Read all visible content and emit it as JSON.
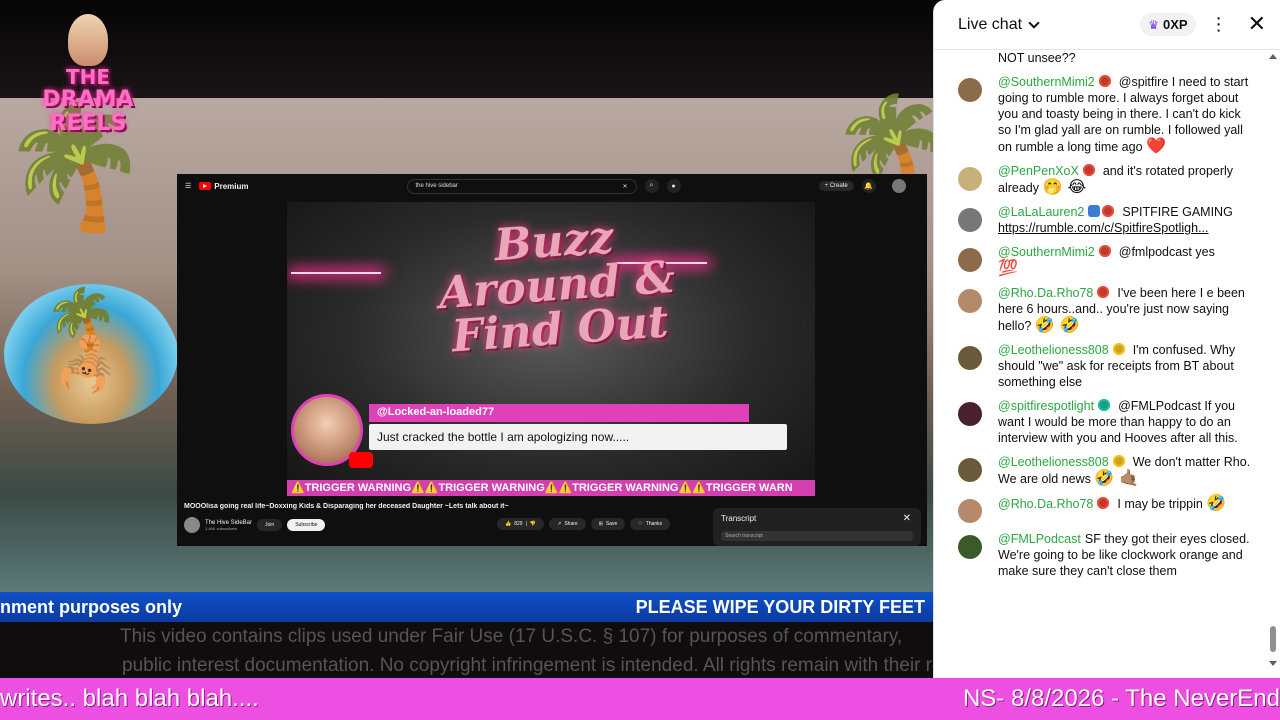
{
  "overlay": {
    "logo_line1": "THE",
    "logo_line2": "DRAMA",
    "logo_line3": "REELS",
    "ticker_left": "nment purposes only",
    "ticker_right": "PLEASE WIPE YOUR DIRTY FEET",
    "disclaimer_line1": "This video contains clips used under Fair Use (17 U.S.C. § 107) for purposes of commentary,",
    "disclaimer_line2": "public interest documentation. No copyright infringement is intended. All rights remain with their respective",
    "bottom_left": "writes.. blah blah blah....",
    "bottom_right": "NS- 8/8/2026 - The NeverEnd"
  },
  "youtube": {
    "brand": "Premium",
    "search_value": "the hive sidebar",
    "create_label": "Create",
    "video_title_art": "Buzz Around & Find Out",
    "comment_user": "@Locked-an-loaded77",
    "comment_text": "Just cracked the bottle I am apologizing now.....",
    "trigger_text": "⚠️TRIGGER WARNING⚠️⚠️TRIGGER WARNING⚠️⚠️TRIGGER WARNING⚠️⚠️TRIGGER WARN",
    "title": "MOOOlisa going real life~Doxxing Kids & Disparaging her deceased Daughter ~Lets talk about it~",
    "channel_name": "The Hive SideBar",
    "channel_subs": "1.46K subscribers",
    "join_label": "Join",
    "subscribe_label": "Subscribe",
    "likes": "829",
    "share_label": "Share",
    "save_label": "Save",
    "thanks_label": "Thanks",
    "transcript_title": "Transcript",
    "transcript_search": "Search transcript"
  },
  "chat": {
    "title": "Live chat",
    "xp": "0XP",
    "messages": [
      {
        "author": "",
        "text": "NOT unsee??",
        "emoji": ""
      },
      {
        "author": "@SouthernMimi2",
        "text": "@spitfire I need to start going to rumble more. I always forget about you and toasty being in there. I can't do kick so I'm glad yall are on rumble. I followed yall on rumble a long time ago",
        "emoji": "❤️"
      },
      {
        "author": "@PenPenXoX",
        "text": "and it's rotated properly already",
        "emoji": "🤭 😂"
      },
      {
        "author": "@LaLaLauren2",
        "text": "SPITFIRE GAMING",
        "link": "https://rumble.com/c/SpitfireSpotligh...",
        "emoji": ""
      },
      {
        "author": "@SouthernMimi2",
        "text": "@fmlpodcast yes",
        "emoji": "💯"
      },
      {
        "author": "@Rho.Da.Rho78",
        "text": "I've been here I e been here 6 hours..and.. you're just now saying hello?",
        "emoji": "🤣 🤣"
      },
      {
        "author": "@Leothelioness808",
        "text": "I'm confused. Why should \"we\" ask for receipts from BT about something else",
        "emoji": ""
      },
      {
        "author": "@spitfirespotlight",
        "text": "@FMLPodcast If you want I would be more than happy to do an interview with you and Hooves after all this.",
        "emoji": ""
      },
      {
        "author": "@Leothelioness808",
        "text": "We don't matter Rho. We are old news",
        "emoji": "🤣 🤙🏽"
      },
      {
        "author": "@Rho.Da.Rho78",
        "text": "I may be trippin",
        "emoji": "🤣"
      },
      {
        "author": "@FMLPodcast",
        "text": "SF they got their eyes closed. We're going to be like clockwork orange and make sure they can't close them",
        "emoji": ""
      }
    ]
  },
  "colors": {
    "chat_author": "#2ba640",
    "bottom_bar": "#ee4fe3",
    "ticker": "#1050c8",
    "trigger": "#d43fb0"
  }
}
